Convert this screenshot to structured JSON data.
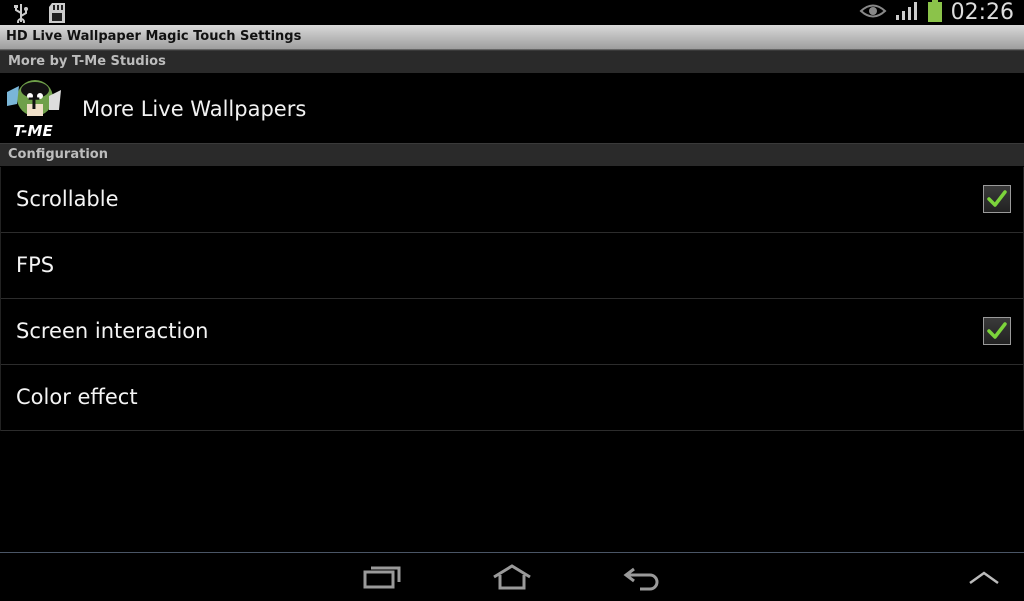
{
  "status_bar": {
    "time": "02:26",
    "icons": [
      "usb-icon",
      "sd-card-icon",
      "eye-icon",
      "signal-icon",
      "battery-icon"
    ],
    "battery_color": "#8bc34a"
  },
  "window": {
    "title": "HD Live Wallpaper Magic Touch Settings"
  },
  "sections": {
    "more": {
      "header": "More by T-Me Studios",
      "promo": {
        "logo_text": "T-ME",
        "label": "More Live Wallpapers"
      }
    },
    "configuration": {
      "header": "Configuration",
      "items": [
        {
          "label": "Scrollable",
          "checked": true
        },
        {
          "label": "FPS",
          "checked": null
        },
        {
          "label": "Screen interaction",
          "checked": true
        },
        {
          "label": "Color effect",
          "checked": null
        }
      ]
    }
  },
  "nav_bar": {
    "buttons": [
      "recent-apps-icon",
      "home-icon",
      "back-icon",
      "up-arrow-icon"
    ]
  },
  "colors": {
    "check_green": "#7cd43b",
    "title_bar": "#c8c8c8",
    "section_header_bg": "#2a2a2a"
  }
}
